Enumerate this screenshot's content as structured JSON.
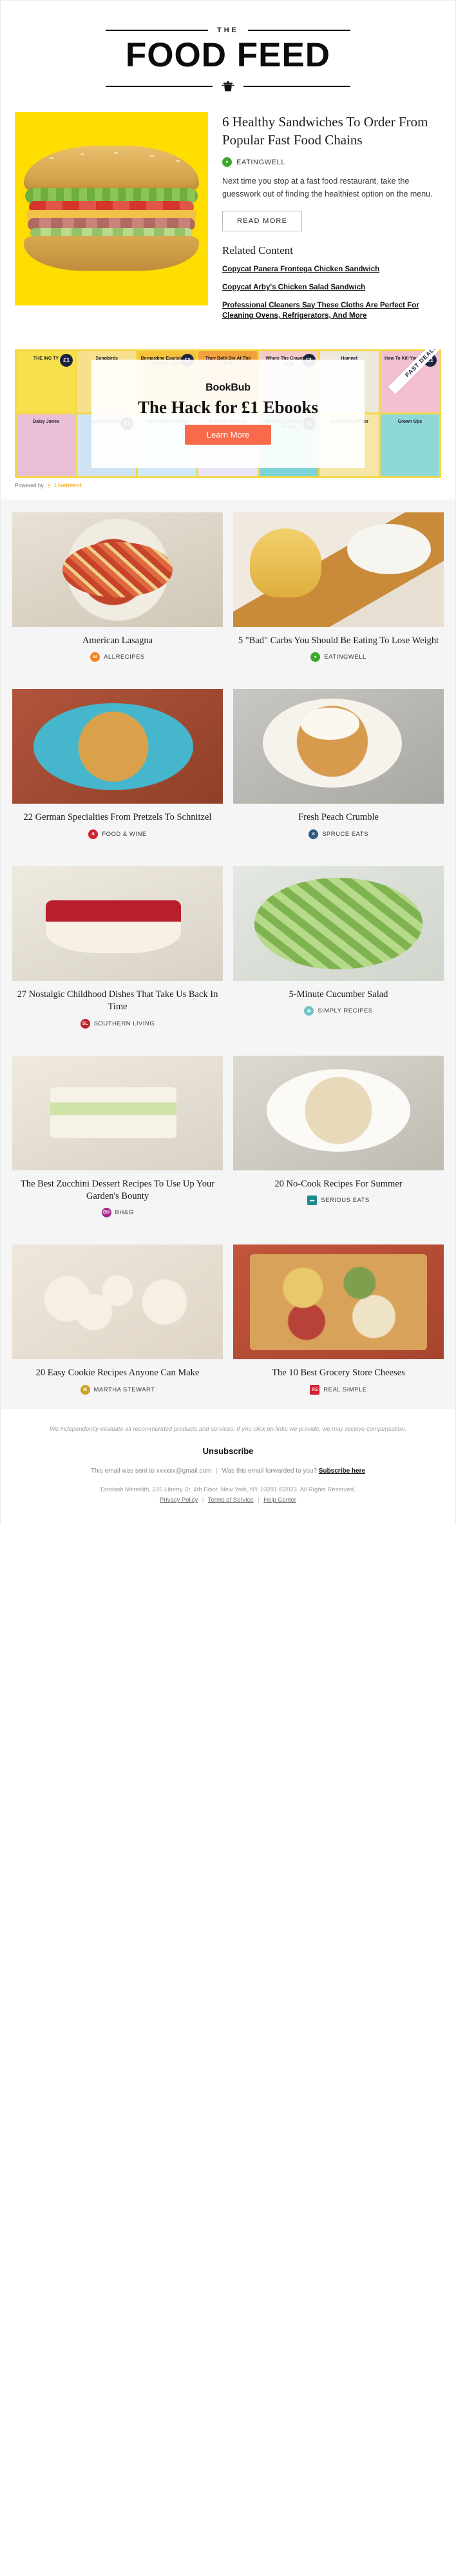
{
  "header": {
    "kicker": "THE",
    "brand": "FOOD FEED",
    "pot_icon": "cooking-pot-icon"
  },
  "feature": {
    "image_alt": "healthy-sandwich-photo",
    "title": "6 Healthy Sandwiches To Order From Popular Fast Food Chains",
    "source": "EATINGWELL",
    "source_badge_color": "#3DA62E",
    "dek": "Next time you stop at a fast food restaurant, take the guesswork out of finding the healthiest option on the menu.",
    "read_more_label": "READ MORE",
    "related_heading": "Related Content",
    "related_links": [
      "Copycat Panera Frontega Chicken Sandwich",
      "Copycat Arby's Chicken Salad Sandwich",
      "Professional Cleaners Say These Cloths Are Perfect For Cleaning Ovens, Refrigerators, And More"
    ]
  },
  "ad": {
    "brand": "BookBub",
    "headline": "The Hack for £1 Ebooks",
    "cta_label": "Learn More",
    "ribbon_label": "PAST DEALS",
    "powered_by_label": "Powered by",
    "powered_by_brand": "LiveIntent",
    "price_badge": "£1",
    "accent_color": "#F96A4A",
    "book_titles_top": [
      "THE ING TY",
      "Songbirds",
      "Bernardine Evaristo Girl, Woman, Other",
      "They Both Die At The End",
      "Where The Crawdads Sing",
      "Hamnet",
      "How To Kill Your Family"
    ],
    "book_titles_bottom": [
      "Daisy Jones",
      "Malibu Rising",
      "One Italian Summer",
      "IT ENDS WITH US Colleen Hoover",
      "The Kiss Quotient Helen Hoang",
      "Something Wilder",
      "Grown Ups"
    ]
  },
  "grid": [
    {
      "cards": [
        {
          "title": "American Lasagna",
          "source": "ALLRECIPES",
          "badge_color": "#F58220",
          "badge_text": "ar",
          "badge_shape": "circle",
          "photo_class": "ph-lasagna"
        },
        {
          "title": "5 \"Bad\" Carbs You Should Be Eating To Lose Weight",
          "source": "EATINGWELL",
          "badge_color": "#3DA62E",
          "badge_text": "●",
          "badge_shape": "circle",
          "photo_class": "ph-carbs"
        }
      ]
    },
    {
      "cards": [
        {
          "title": "22 German Specialties From Pretzels To Schnitzel",
          "source": "FOOD & WINE",
          "badge_color": "#D1202F",
          "badge_text": "&",
          "badge_shape": "circle",
          "photo_class": "ph-schnitzel"
        },
        {
          "title": "Fresh Peach Crumble",
          "source": "SPRUCE EATS",
          "badge_color": "#2B5B84",
          "badge_text": "✕",
          "badge_shape": "circle",
          "photo_class": "ph-crumble"
        }
      ]
    },
    {
      "cards": [
        {
          "title": "27 Nostalgic Childhood Dishes That Take Us Back In Time",
          "source": "SOUTHERN LIVING",
          "badge_color": "#C0202C",
          "badge_text": "SL",
          "badge_shape": "circle",
          "photo_class": "ph-nostalgic"
        },
        {
          "title": "5-Minute Cucumber Salad",
          "source": "SIMPLY RECIPES",
          "badge_color": "#6CC4C4",
          "badge_text": "✻",
          "badge_shape": "circle",
          "photo_class": "ph-cucumber"
        }
      ]
    },
    {
      "cards": [
        {
          "title": "The Best Zucchini Dessert Recipes To Use Up Your Garden's Bounty",
          "source": "BH&G",
          "badge_color": "#A32C8C",
          "badge_text": "BH",
          "badge_shape": "circle",
          "photo_class": "ph-zucchini"
        },
        {
          "title": "20 No-Cook Recipes For Summer",
          "source": "SERIOUS EATS",
          "badge_color": "#1A8C8C",
          "badge_text": "▬",
          "badge_shape": "sq",
          "photo_class": "ph-nocook"
        }
      ]
    },
    {
      "cards": [
        {
          "title": "20 Easy Cookie Recipes Anyone Can Make",
          "source": "MARTHA STEWART",
          "badge_color": "#C9A227",
          "badge_text": "M",
          "badge_shape": "circle",
          "photo_class": "ph-cookie"
        },
        {
          "title": "The 10 Best Grocery Store Cheeses",
          "source": "REAL SIMPLE",
          "badge_color": "#D1202F",
          "badge_text": "RS",
          "badge_shape": "sq",
          "photo_class": "ph-cheese"
        }
      ]
    }
  ],
  "footer": {
    "disclaimer": "We independently evaluate all recommended products and services. If you click on links we provide, we may receive compensation.",
    "unsubscribe_label": "Unsubscribe",
    "sent_to_prefix": "This email was sent to xxxxxx@gmail.com",
    "sent_sep": "|",
    "forwarded_text": "Was this email forwarded to you?",
    "subscribe_label": "Subscribe here",
    "address": "Dotdash Meredith, 225 Liberty St, 4th Floor, New York, NY 10281 ©2023. All Rights Reserved.",
    "privacy_label": "Privacy Policy",
    "terms_label": "Terms of Service",
    "help_label": "Help Center"
  }
}
